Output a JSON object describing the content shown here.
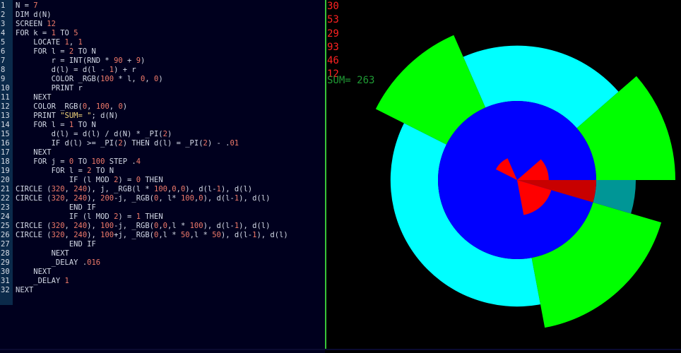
{
  "editor": {
    "lines": [
      {
        "n": "1",
        "t": "N = 7"
      },
      {
        "n": "2",
        "t": "DIM d(N)"
      },
      {
        "n": "3",
        "t": "SCREEN 12"
      },
      {
        "n": "4",
        "t": "FOR k = 1 TO 5"
      },
      {
        "n": "5",
        "t": "    LOCATE 1, 1"
      },
      {
        "n": "6",
        "t": "    FOR l = 2 TO N"
      },
      {
        "n": "7",
        "t": "        r = INT(RND * 90 + 9)"
      },
      {
        "n": "8",
        "t": "        d(l) = d(l - 1) + r"
      },
      {
        "n": "9",
        "t": "        COLOR _RGB(100 * l, 0, 0)"
      },
      {
        "n": "10",
        "t": "        PRINT r"
      },
      {
        "n": "11",
        "t": "    NEXT"
      },
      {
        "n": "12",
        "t": "    COLOR _RGB(0, 100, 0)"
      },
      {
        "n": "13",
        "t": "    PRINT \"SUM= \"; d(N)"
      },
      {
        "n": "14",
        "t": "    FOR l = 1 TO N"
      },
      {
        "n": "15",
        "t": "        d(l) = d(l) / d(N) * _PI(2)"
      },
      {
        "n": "16",
        "t": "        IF d(l) >= _PI(2) THEN d(l) = _PI(2) - .01"
      },
      {
        "n": "17",
        "t": "    NEXT"
      },
      {
        "n": "18",
        "t": "    FOR j = 0 TO 100 STEP .4"
      },
      {
        "n": "19",
        "t": "        FOR l = 2 TO N"
      },
      {
        "n": "20",
        "t": "            IF (l MOD 2) = 0 THEN"
      },
      {
        "n": "21",
        "t": "CIRCLE (320, 240), j, _RGB(l * 100,0,0), d(l-1), d(l)"
      },
      {
        "n": "22",
        "t": "CIRCLE (320, 240), 200-j, _RGB(0, l* 100,0), d(l-1), d(l)"
      },
      {
        "n": "23",
        "t": "            END IF"
      },
      {
        "n": "24",
        "t": "            IF (l MOD 2) = 1 THEN"
      },
      {
        "n": "25",
        "t": "CIRCLE (320, 240), 100-j, _RGB(0,0,l * 100), d(l-1), d(l)"
      },
      {
        "n": "26",
        "t": "CIRCLE (320, 240), 100+j, _RGB(0,l * 50,l * 50), d(l-1), d(l)"
      },
      {
        "n": "27",
        "t": "            END IF"
      },
      {
        "n": "28",
        "t": "        NEXT"
      },
      {
        "n": "29",
        "t": "        _DELAY .016"
      },
      {
        "n": "30",
        "t": "    NEXT"
      },
      {
        "n": "31",
        "t": "    _DELAY 1"
      },
      {
        "n": "32",
        "t": "NEXT"
      }
    ]
  },
  "output": {
    "numbers": [
      "30",
      "53",
      "29",
      "93",
      "46",
      "12"
    ],
    "sum_label": "SUM= 263"
  },
  "colors": {
    "editor_bg": "#00001e",
    "gutter_bg": "#0b2a4a",
    "red": "#ff0000",
    "dark_red": "#c80000",
    "blue": "#0000ff",
    "green": "#00ff00",
    "dark_green": "#00c800",
    "cyan": "#00ffff",
    "teal": "#009696"
  }
}
